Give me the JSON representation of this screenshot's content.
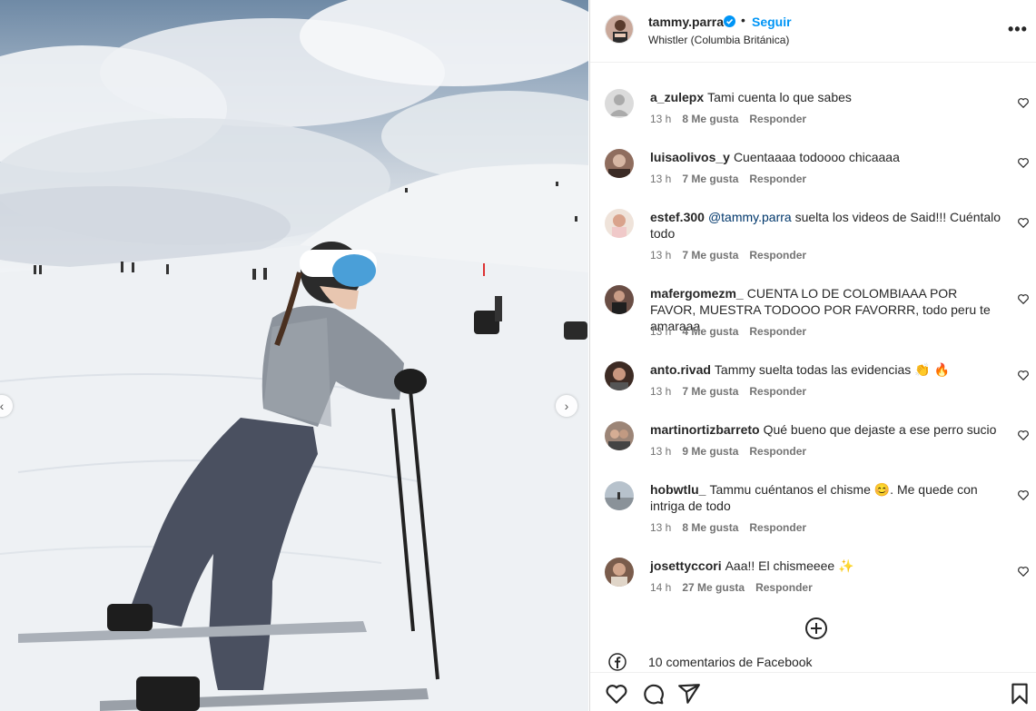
{
  "post": {
    "username": "tammy.parra",
    "separator": "•",
    "follow_label": "Seguir",
    "location": "Whistler (Columbia Británica)",
    "more_label": "•••"
  },
  "comments": [
    {
      "user": "a_zulepx",
      "text": "Tami cuenta lo que sabes",
      "time": "13 h",
      "likes": "8 Me gusta",
      "reply": "Responder"
    },
    {
      "user": "luisaolivos_y",
      "text": "Cuentaaaa todoooo chicaaaa",
      "time": "13 h",
      "likes": "7 Me gusta",
      "reply": "Responder"
    },
    {
      "user": "estef.300",
      "mention": "@tammy.parra",
      "text": "suelta los videos de Said!!! Cuéntalo todo",
      "time": "13 h",
      "likes": "7 Me gusta",
      "reply": "Responder"
    },
    {
      "user": "mafergomezm_",
      "text": "CUENTA LO DE COLOMBIAAA POR FAVOR, MUESTRA TODOOO POR FAVORRR, todo peru te amaraaa",
      "time": "13 h",
      "likes": "4 Me gusta",
      "reply": "Responder"
    },
    {
      "user": "anto.rivad",
      "text": "Tammy suelta todas las evidencias 👏 🔥",
      "time": "13 h",
      "likes": "7 Me gusta",
      "reply": "Responder"
    },
    {
      "user": "martinortizbarreto",
      "text": "Qué bueno que dejaste a ese perro sucio",
      "time": "13 h",
      "likes": "9 Me gusta",
      "reply": "Responder"
    },
    {
      "user": "hobwtlu_",
      "text": "Tammu cuéntanos el chisme 😊. Me quede con intriga de todo",
      "time": "13 h",
      "likes": "8 Me gusta",
      "reply": "Responder"
    },
    {
      "user": "josettyccori",
      "text": "Aaa!! El chismeeee ✨",
      "time": "14 h",
      "likes": "27 Me gusta",
      "reply": "Responder"
    }
  ],
  "facebook": {
    "label": "10 comentarios de Facebook"
  },
  "colors": {
    "link": "#0095f6",
    "mention": "#00376b",
    "muted": "#737373",
    "text": "#262626"
  }
}
